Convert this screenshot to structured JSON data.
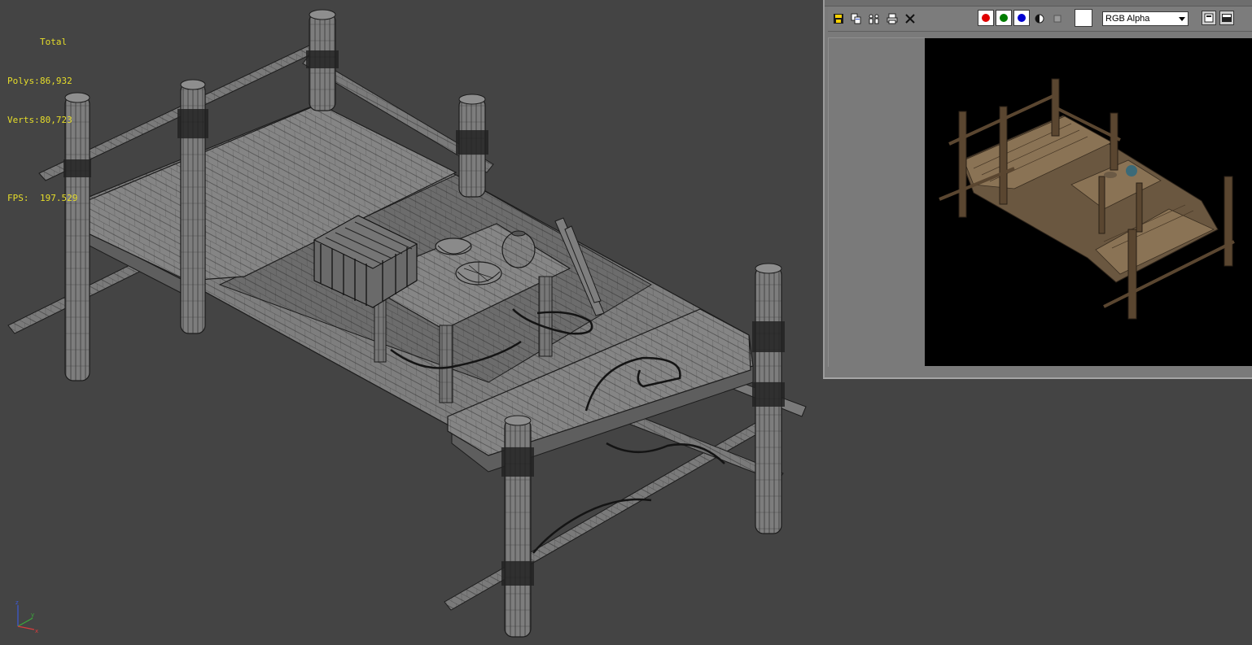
{
  "viewport": {
    "stats": {
      "title": "Total",
      "polys_label": "Polys:",
      "polys_value": "86,932",
      "verts_label": "Verts:",
      "verts_value": "80,723",
      "fps_label": "FPS:",
      "fps_value": "197.529"
    },
    "axis": {
      "x": "x",
      "y": "y",
      "z": "z"
    },
    "colors": {
      "background": "#444444",
      "stats_text": "#e6dd2a",
      "mesh_fill": "#7e7e7e",
      "wire": "#1c1c1c"
    }
  },
  "render_window": {
    "toolbar": {
      "save_icon": "floppy-save-icon",
      "copy_icon": "copy-image-icon",
      "clone_icon": "clone-window-icon",
      "print_icon": "print-icon",
      "clear_icon": "clear-x-icon",
      "channels": [
        {
          "name": "red-channel",
          "color": "#e00000"
        },
        {
          "name": "green-channel",
          "color": "#007d00"
        },
        {
          "name": "blue-channel",
          "color": "#0000d0"
        }
      ],
      "alpha_icon": "alpha-toggle-icon",
      "mono_icon": "monochrome-icon",
      "channel_display": "RGB Alpha",
      "swatch_color": "#ffffff"
    },
    "colors": {
      "frame": "#7a7a7a",
      "render_bg": "#000000"
    }
  }
}
